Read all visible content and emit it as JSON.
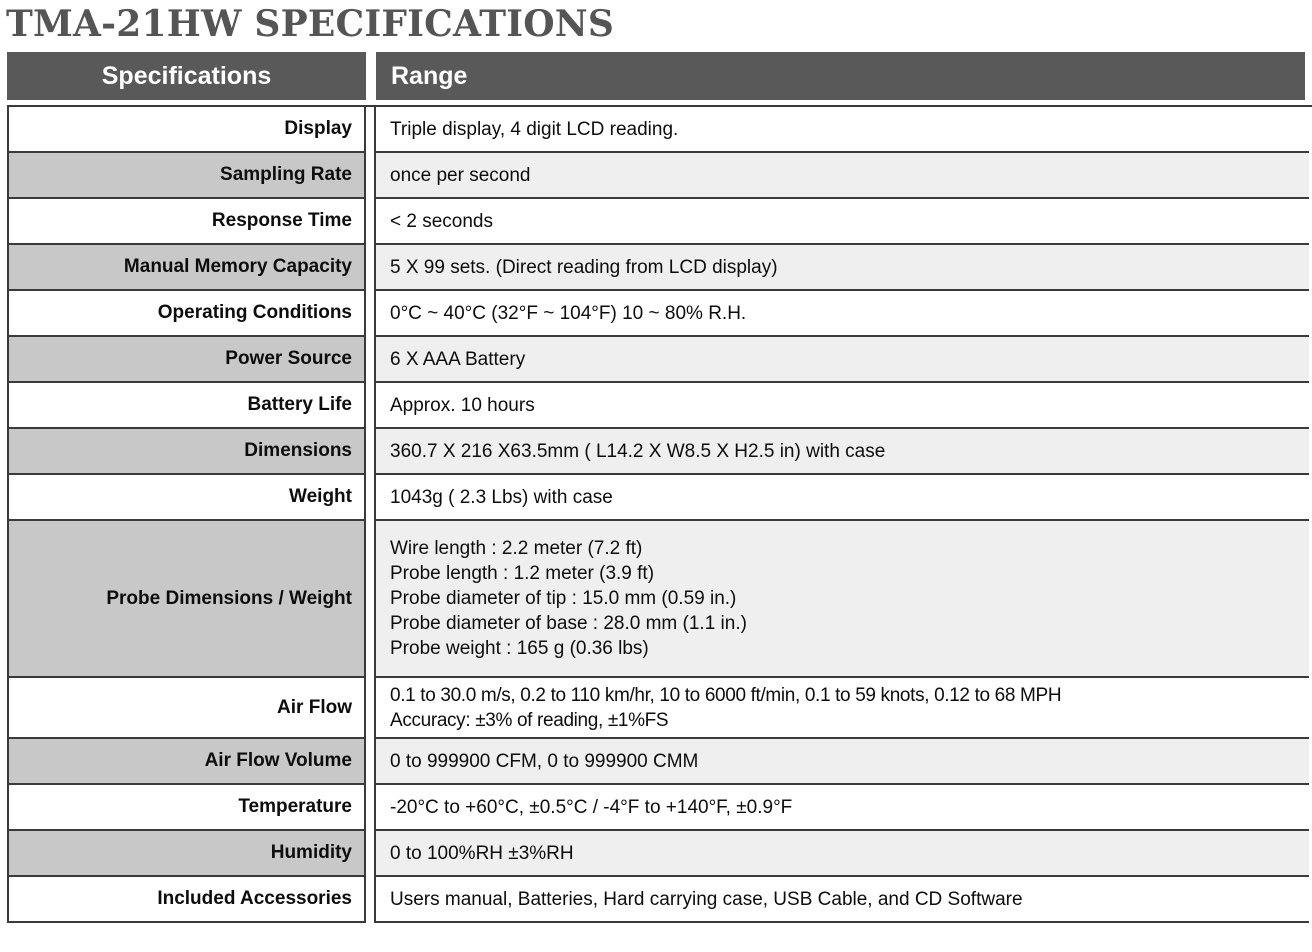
{
  "title": "TMA-21HW SPECIFICATIONS",
  "table": {
    "headers": {
      "spec": "Specifications",
      "range": "Range"
    },
    "colors": {
      "header_background": "#595959",
      "header_text": "#ffffff",
      "label_alt_background": "#c8c8c8",
      "value_alt_background": "#efefef",
      "border": "#3a3a3a",
      "title_text": "#555555"
    },
    "rows": [
      {
        "label": "Display",
        "value": "Triple display, 4 digit LCD reading."
      },
      {
        "label": "Sampling Rate",
        "value": "once per second"
      },
      {
        "label": "Response Time",
        "value": "< 2 seconds"
      },
      {
        "label": "Manual Memory Capacity",
        "value": "5 X 99 sets. (Direct reading from LCD display)"
      },
      {
        "label": "Operating Conditions",
        "value": "0°C ~ 40°C (32°F ~ 104°F) 10 ~ 80% R.H."
      },
      {
        "label": "Power Source",
        "value": "6 X AAA Battery"
      },
      {
        "label": "Battery Life",
        "value": "Approx. 10 hours"
      },
      {
        "label": "Dimensions",
        "value": "360.7 X 216 X63.5mm ( L14.2 X W8.5 X H2.5 in) with case"
      },
      {
        "label": "Weight",
        "value": "1043g ( 2.3 Lbs) with case"
      },
      {
        "label": "Probe Dimensions / Weight",
        "value": "Wire length : 2.2 meter (7.2 ft)\nProbe length : 1.2 meter (3.9 ft)\nProbe diameter of tip : 15.0 mm (0.59 in.)\nProbe diameter of base : 28.0 mm (1.1 in.)\nProbe weight : 165 g (0.36 lbs)"
      },
      {
        "label": "Air Flow",
        "value": "0.1 to 30.0 m/s, 0.2 to 110 km/hr, 10 to 6000 ft/min, 0.1 to 59 knots, 0.12 to 68 MPH\nAccuracy: ±3% of reading, ±1%FS"
      },
      {
        "label": "Air Flow Volume",
        "value": "0 to 999900 CFM, 0 to 999900 CMM"
      },
      {
        "label": "Temperature",
        "value": "-20°C to +60°C, ±0.5°C / -4°F to +140°F, ±0.9°F"
      },
      {
        "label": "Humidity",
        "value": "0 to 100%RH ±3%RH"
      },
      {
        "label": "Included Accessories",
        "value": "Users manual, Batteries, Hard carrying case, USB Cable, and CD Software"
      }
    ]
  }
}
